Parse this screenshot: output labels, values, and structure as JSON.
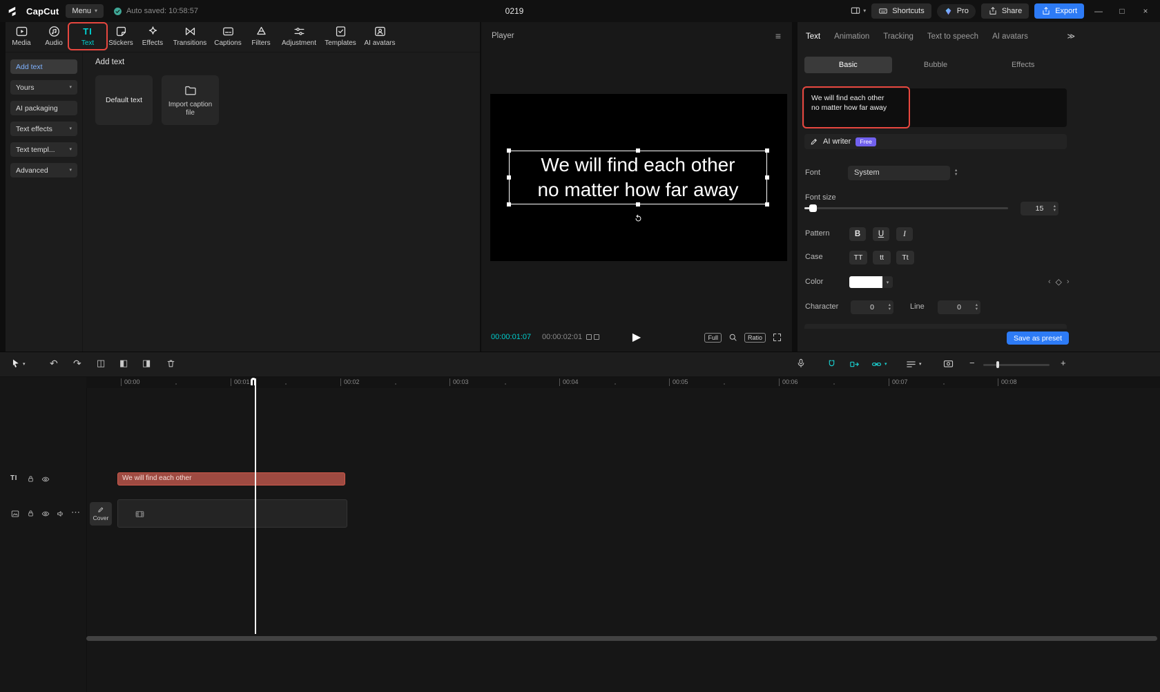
{
  "icons": {
    "chevron_down": "▾",
    "stepper_up": "▴",
    "stepper_down": "▾",
    "hamburger": "≡",
    "more_dots": "⋯",
    "undo": "↶",
    "redo": "↷",
    "split": "◫",
    "split_left": "◧",
    "split_right": "◨",
    "play": "▶",
    "minimize": "—",
    "maximize": "□",
    "close": "×",
    "zoom_out": "−",
    "zoom_in": "+",
    "prev": "‹",
    "next": "›",
    "diamond": "◇",
    "double_chevron": "≫",
    "text_tool": "TI"
  },
  "colors": {
    "accent_cyan": "#00d2d2",
    "export_blue": "#2d7bf6",
    "annotation_red": "#e8473f",
    "clip_red": "#9e4a41",
    "free_badge_purple": "#7161ef"
  },
  "titlebar": {
    "app_name": "CapCut",
    "menu_label": "Menu",
    "autosave_text": "Auto saved: 10:58:57",
    "project_name": "0219",
    "shortcuts_label": "Shortcuts",
    "pro_label": "Pro",
    "share_label": "Share",
    "export_label": "Export"
  },
  "ribbon": {
    "tools": [
      {
        "label": "Media"
      },
      {
        "label": "Audio"
      },
      {
        "label": "Text",
        "selected": true
      },
      {
        "label": "Stickers"
      },
      {
        "label": "Effects"
      },
      {
        "label": "Transitions"
      },
      {
        "label": "Captions"
      },
      {
        "label": "Filters"
      },
      {
        "label": "Adjustment"
      },
      {
        "label": "Templates"
      },
      {
        "label": "AI avatars"
      }
    ]
  },
  "sidebar": {
    "items": [
      {
        "label": "Add text",
        "selected": true
      },
      {
        "label": "Yours",
        "chevron": true
      },
      {
        "label": "AI packaging"
      },
      {
        "label": "Text effects",
        "chevron": true
      },
      {
        "label": "Text templ...",
        "chevron": true
      },
      {
        "label": "Advanced",
        "chevron": true
      }
    ]
  },
  "content": {
    "header": "Add text",
    "default_text_label": "Default text",
    "import_caption_label": "Import caption file"
  },
  "player": {
    "title": "Player",
    "overlay_text": "We will find each other\nno matter how far away",
    "current_time": "00:00:01:07",
    "duration": "00:00:02:01",
    "full_label": "Full",
    "ratio_label": "Ratio"
  },
  "inspector": {
    "tabs": [
      "Text",
      "Animation",
      "Tracking",
      "Text to speech",
      "AI avatars"
    ],
    "subtabs": [
      "Basic",
      "Bubble",
      "Effects"
    ],
    "text_value": "We will find each other\nno matter how far away",
    "ai_writer_label": "AI writer",
    "free_badge": "Free",
    "font_label": "Font",
    "font_value": "System",
    "font_size_label": "Font size",
    "font_size_value": "15",
    "pattern_label": "Pattern",
    "pattern_options": [
      "B",
      "U",
      "I"
    ],
    "case_label": "Case",
    "case_options": [
      "TT",
      "tt",
      "Tt"
    ],
    "color_label": "Color",
    "color_value": "#FFFFFF",
    "character_label": "Character",
    "character_value": "0",
    "line_label": "Line",
    "line_value": "0",
    "save_preset_label": "Save as preset"
  },
  "timeline": {
    "ruler": [
      "00:00",
      "00:01",
      "00:02",
      "00:03",
      "00:04",
      "00:05",
      "00:06",
      "00:07",
      "00:08"
    ],
    "text_clip_label": "We will find each other",
    "cover_label": "Cover"
  }
}
